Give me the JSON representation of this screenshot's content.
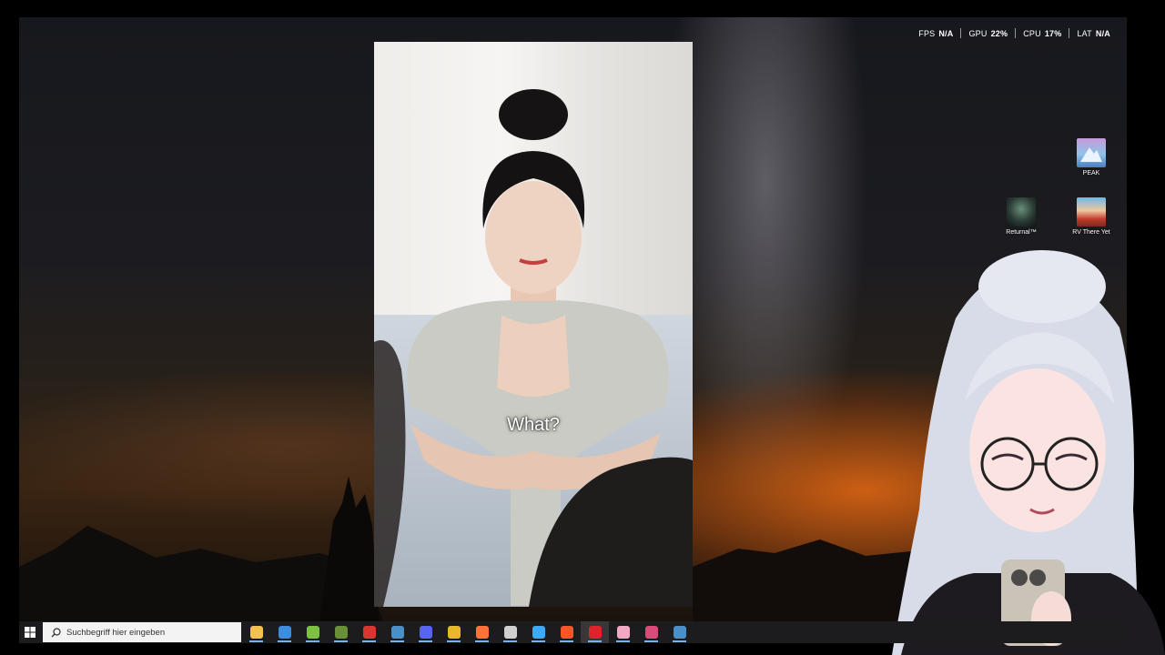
{
  "overlay": {
    "fps_label": "FPS",
    "fps_value": "N/A",
    "gpu_label": "GPU",
    "gpu_value": "22%",
    "cpu_label": "CPU",
    "cpu_value": "17%",
    "lat_label": "LAT",
    "lat_value": "N/A"
  },
  "desktop_icons": [
    {
      "label": "PEAK",
      "icon": "peak-game-icon"
    },
    {
      "label": "Returnal™",
      "icon": "returnal-game-icon"
    },
    {
      "label": "RV There Yet",
      "icon": "rv-there-yet-game-icon"
    }
  ],
  "video": {
    "subtitle": "What?"
  },
  "taskbar": {
    "search_placeholder": "Suchbegriff hier eingeben",
    "apps": [
      {
        "icon": "file-explorer-icon",
        "color": "#f2c14e"
      },
      {
        "icon": "microsoft-store-icon",
        "color": "#3c8de0"
      },
      {
        "icon": "android-app-icon",
        "color": "#7cc142"
      },
      {
        "icon": "minecraft-icon",
        "color": "#6a8f3a"
      },
      {
        "icon": "news-app-icon",
        "color": "#d9362f"
      },
      {
        "icon": "steam-icon",
        "color": "#4a8fc6"
      },
      {
        "icon": "discord-icon",
        "color": "#5865f2"
      },
      {
        "icon": "chrome-icon",
        "color": "#e6b82c"
      },
      {
        "icon": "firefox-icon",
        "color": "#ff7139"
      },
      {
        "icon": "obs-icon",
        "color": "#d0d0d0"
      },
      {
        "icon": "sync-app-icon",
        "color": "#3fa9f5"
      },
      {
        "icon": "brave-icon",
        "color": "#fb542b"
      },
      {
        "icon": "opera-icon",
        "color": "#e0222d"
      },
      {
        "icon": "vtuber-app-icon",
        "color": "#f2a7c3"
      },
      {
        "icon": "media-app-icon",
        "color": "#d94c7a"
      },
      {
        "icon": "steam-icon",
        "color": "#4a8fc6"
      }
    ],
    "active_index": 12
  }
}
